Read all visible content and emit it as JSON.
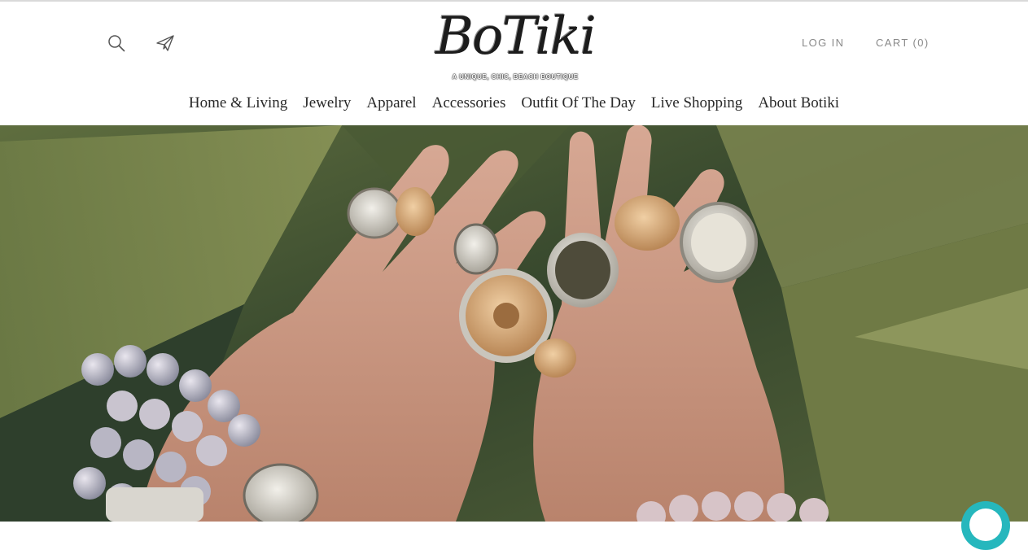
{
  "header": {
    "logo": {
      "wordmark": "BoTiki",
      "tagline": "A UNIQUE, CHIC, BEACH BOUTIQUE"
    },
    "icons": {
      "search": "search-icon",
      "newsletter": "paper-plane-icon"
    },
    "login_label": "LOG IN",
    "cart_label": "CART (0)"
  },
  "nav": {
    "items": [
      {
        "label": "Home & Living"
      },
      {
        "label": "Jewelry"
      },
      {
        "label": "Apparel"
      },
      {
        "label": "Accessories"
      },
      {
        "label": "Outfit Of The Day"
      },
      {
        "label": "Live Shopping"
      },
      {
        "label": "About Botiki"
      }
    ]
  },
  "hero": {
    "image": "hands-wearing-rings-and-beaded-bracelets-photo"
  },
  "chat": {
    "icon": "chat-bubble-icon",
    "color": "#26b7bd"
  },
  "colors": {
    "nav_text": "#2a2a2a",
    "utility_text": "#8a8a8a",
    "chat_accent": "#26b7bd"
  }
}
